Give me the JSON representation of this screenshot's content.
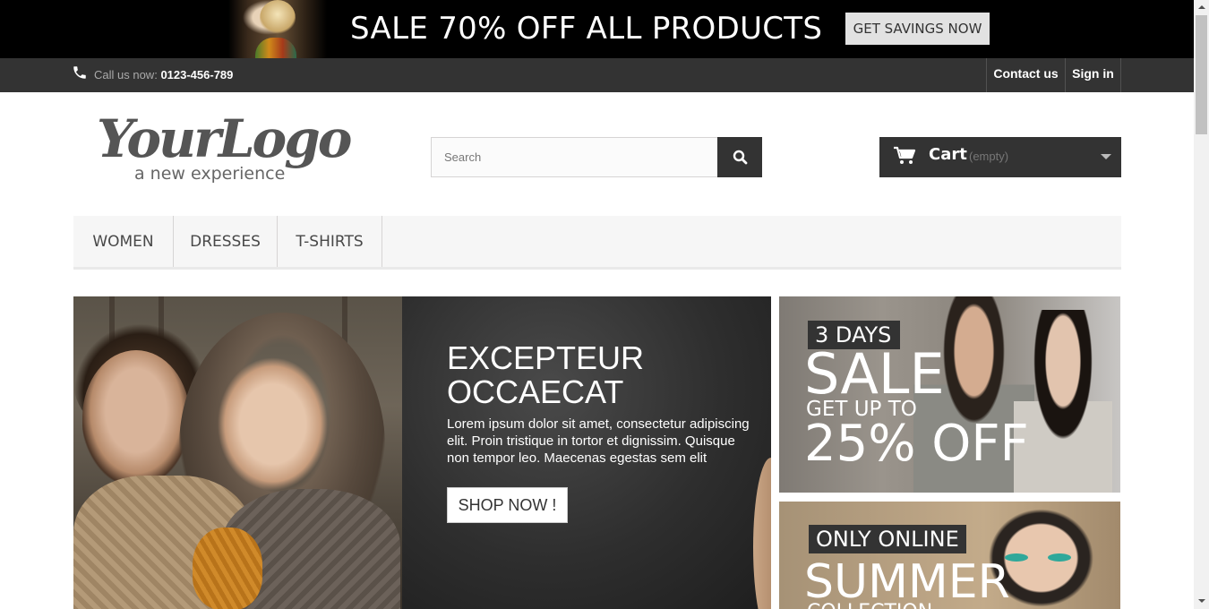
{
  "promo": {
    "text": "SALE 70% OFF ALL PRODUCTS",
    "button_label": "GET SAVINGS NOW"
  },
  "topbar": {
    "call_label": "Call us now:",
    "phone": "0123-456-789",
    "contact_label": "Contact us",
    "signin_label": "Sign in"
  },
  "logo": {
    "main": "YourLogo",
    "sub": "a new experience"
  },
  "search": {
    "placeholder": "Search",
    "value": ""
  },
  "cart": {
    "label": "Cart",
    "status": "(empty)"
  },
  "menu": {
    "items": [
      {
        "label": "WOMEN"
      },
      {
        "label": "DRESSES"
      },
      {
        "label": "T-SHIRTS"
      }
    ]
  },
  "slider": {
    "title": "EXCEPTEUR OCCAECAT",
    "text": "Lorem ipsum dolor sit amet, consectetur adipiscing elit. Proin tristique in tortor et dignissim. Quisque non tempor leo. Maecenas egestas sem elit",
    "button_label": "SHOP NOW !"
  },
  "banners": {
    "sale": {
      "tag": "3 DAYS",
      "headline": "SALE",
      "subline": "GET UP TO",
      "offer": "25% OFF"
    },
    "summer": {
      "tag": "ONLY ONLINE",
      "headline": "SUMMER",
      "subline": "COLLECTION"
    }
  },
  "colors": {
    "dark": "#333333",
    "promo_bg": "#000000",
    "menu_bg": "#f6f6f6"
  }
}
